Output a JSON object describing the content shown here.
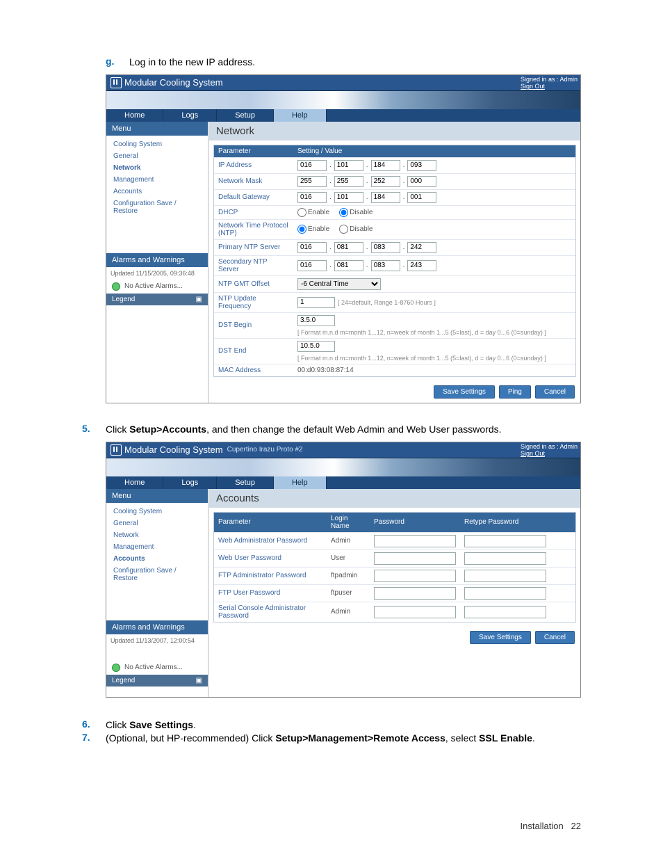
{
  "steps": {
    "g": {
      "letter": "g.",
      "text": "Log in to the new IP address."
    },
    "s5": {
      "num": "5.",
      "pre": "Click ",
      "bold": "Setup>Accounts",
      "post": ", and then change the default Web Admin and Web User passwords."
    },
    "s6": {
      "num": "6.",
      "pre": "Click ",
      "bold": "Save Settings",
      "post": "."
    },
    "s7": {
      "num": "7.",
      "pre": "(Optional, but HP-recommended) Click ",
      "bold1": "Setup>Management>Remote Access",
      "mid": ", select ",
      "bold2": "SSL Enable",
      "post": "."
    }
  },
  "app": {
    "title": "Modular Cooling System",
    "subtitle2": "Cupertino Irazu Proto #2",
    "signed_in": "Signed in as : Admin",
    "sign_out": "Sign Out",
    "tabs": {
      "home": "Home",
      "logs": "Logs",
      "setup": "Setup",
      "help": "Help"
    },
    "menu_hdr": "Menu",
    "menu": {
      "cooling": "Cooling System",
      "general": "General",
      "network": "Network",
      "management": "Management",
      "accounts": "Accounts",
      "config": "Configuration Save / Restore"
    },
    "alarms_hdr": "Alarms and Warnings",
    "updated1": "Updated 11/15/2005, 09:36:48",
    "updated2": "Updated 11/13/2007, 12:00:54",
    "no_alarms": "No Active Alarms...",
    "legend": "Legend",
    "buttons": {
      "save": "Save Settings",
      "ping": "Ping",
      "cancel": "Cancel"
    }
  },
  "network": {
    "title": "Network",
    "hdr_param": "Parameter",
    "hdr_val": "Setting / Value",
    "rows": {
      "ip": {
        "label": "IP Address",
        "o1": "016",
        "o2": "101",
        "o3": "184",
        "o4": "093"
      },
      "mask": {
        "label": "Network Mask",
        "o1": "255",
        "o2": "255",
        "o3": "252",
        "o4": "000"
      },
      "gw": {
        "label": "Default Gateway",
        "o1": "016",
        "o2": "101",
        "o3": "184",
        "o4": "001"
      },
      "dhcp": {
        "label": "DHCP",
        "enable": "Enable",
        "disable": "Disable"
      },
      "ntp": {
        "label": "Network Time Protocol (NTP)",
        "enable": "Enable",
        "disable": "Disable"
      },
      "ntp1": {
        "label": "Primary NTP Server",
        "o1": "016",
        "o2": "081",
        "o3": "083",
        "o4": "242"
      },
      "ntp2": {
        "label": "Secondary NTP Server",
        "o1": "016",
        "o2": "081",
        "o3": "083",
        "o4": "243"
      },
      "gmt": {
        "label": "NTP GMT Offset",
        "value": "-6 Central Time"
      },
      "upd": {
        "label": "NTP Update Frequency",
        "value": "1",
        "hint": "[ 24=default, Range 1-8760 Hours ]"
      },
      "dstb": {
        "label": "DST Begin",
        "value": "3.5.0",
        "hint": "[ Format m.n.d m=month 1...12, n=week of month 1...5 (5=last), d = day 0...6 (0=sunday) ]"
      },
      "dste": {
        "label": "DST End",
        "value": "10.5.0",
        "hint": "[ Format m.n.d m=month 1...12, n=week of month 1...5 (5=last), d = day 0...6 (0=sunday) ]"
      },
      "mac": {
        "label": "MAC Address",
        "value": "00:d0:93:08:87:14"
      }
    }
  },
  "accounts": {
    "title": "Accounts",
    "hdr_param": "Parameter",
    "hdr_login": "Login Name",
    "hdr_pw": "Password",
    "hdr_rpw": "Retype Password",
    "rows": [
      {
        "label": "Web Administrator Password",
        "login": "Admin"
      },
      {
        "label": "Web User Password",
        "login": "User"
      },
      {
        "label": "FTP Administrator Password",
        "login": "ftpadmin"
      },
      {
        "label": "FTP User Password",
        "login": "ftpuser"
      },
      {
        "label": "Serial Console Administrator Password",
        "login": "Admin"
      }
    ]
  },
  "footer": {
    "section": "Installation",
    "page": "22"
  }
}
